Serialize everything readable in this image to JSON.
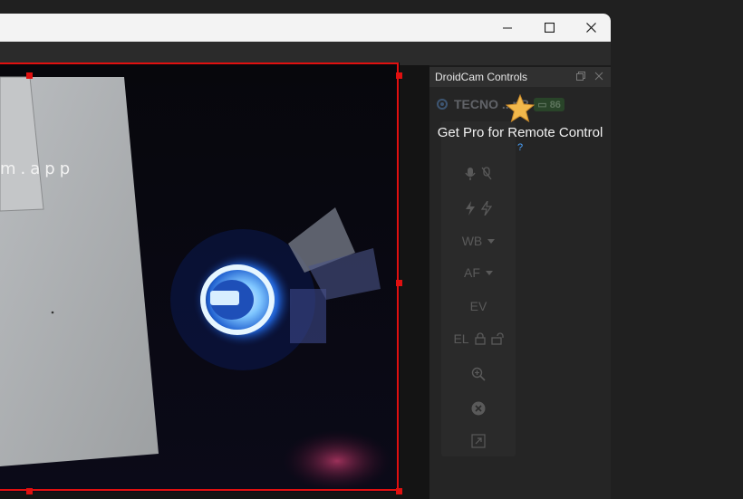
{
  "window": {
    "minimize_label": "",
    "maximize_label": "",
    "close_label": ""
  },
  "preview": {
    "overlay_text": "m.app"
  },
  "dock": {
    "title": "DroidCam Controls",
    "device_name": "TECNO ...nB",
    "battery": "86"
  },
  "pro": {
    "message": "Get Pro for Remote Control",
    "help": "?"
  },
  "controls": {
    "wb_label": "WB",
    "af_label": "AF",
    "ev_label": "EV",
    "el_label": "EL"
  },
  "colors": {
    "selection": "#e01010",
    "star": "#f2b84b",
    "link": "#4aa3ff"
  }
}
